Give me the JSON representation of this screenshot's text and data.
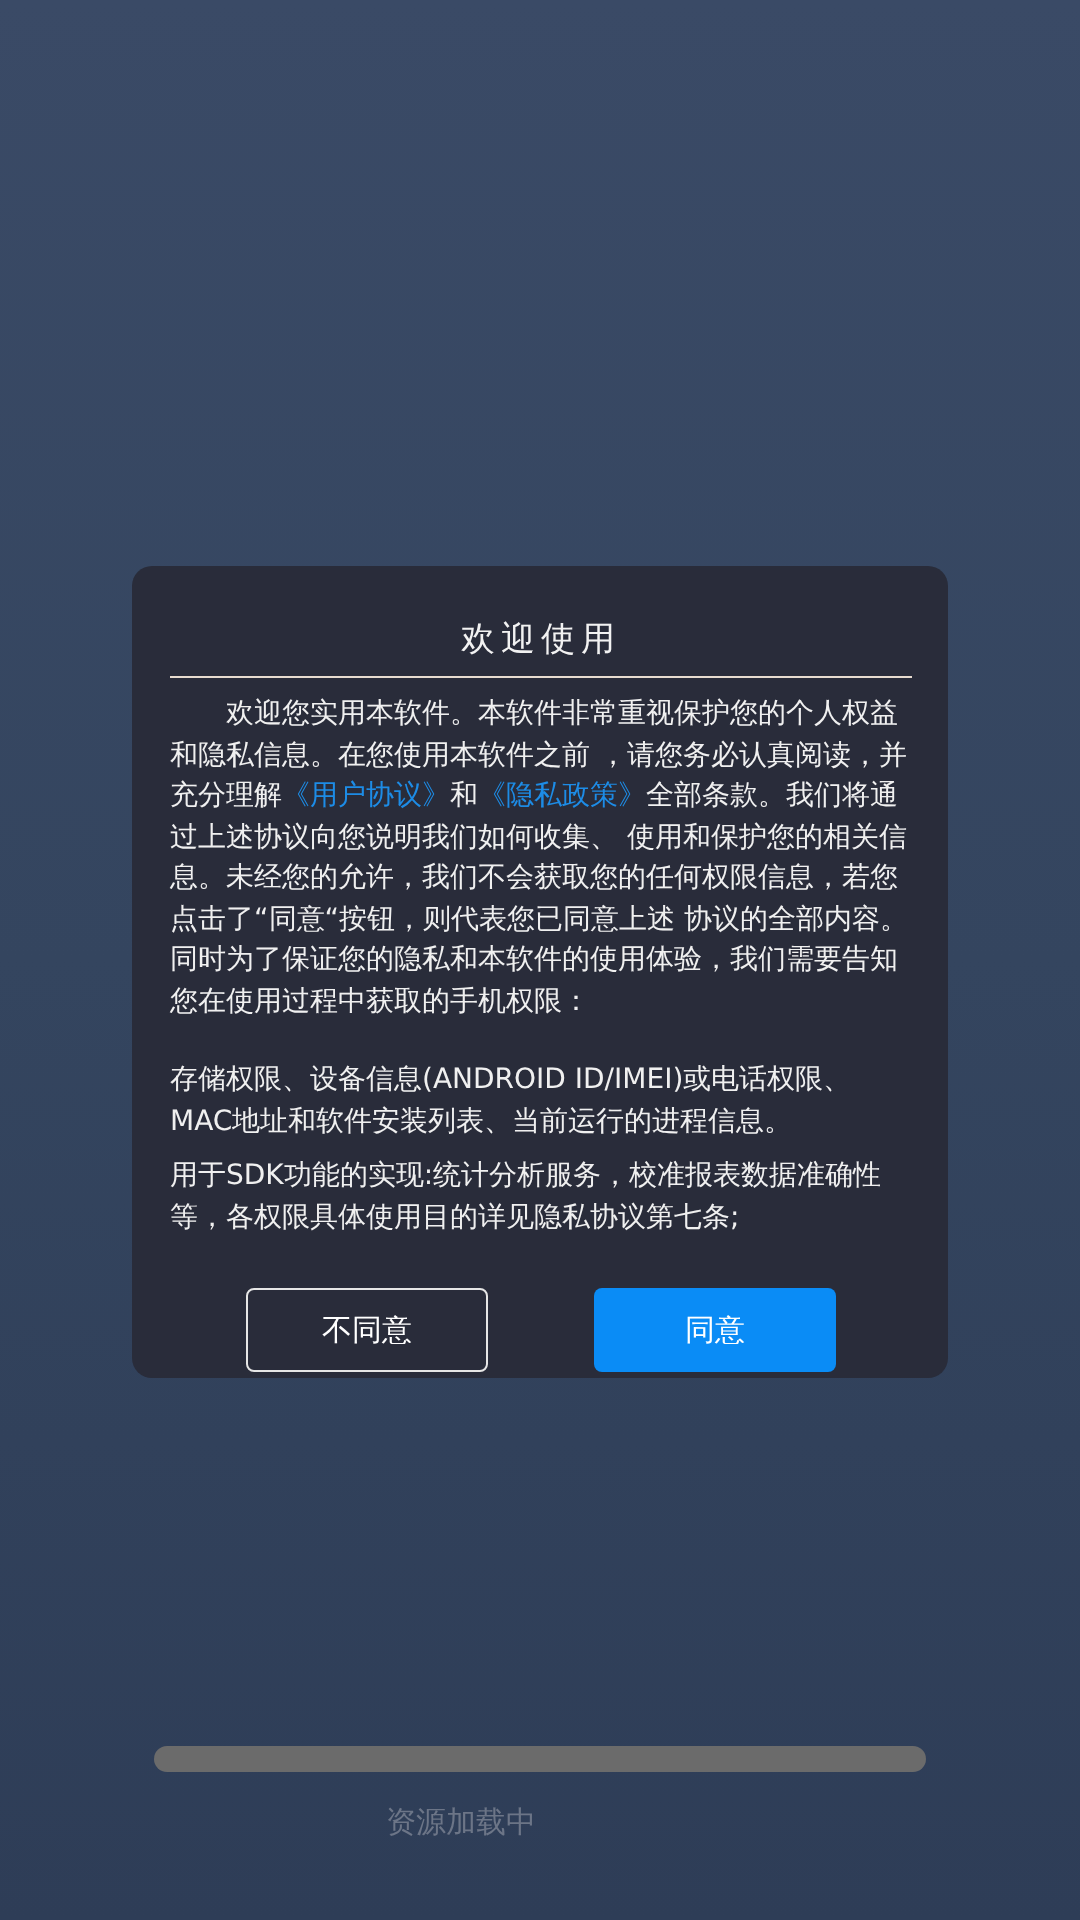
{
  "dialog": {
    "title": "欢迎使用",
    "intro": {
      "before": "欢迎您实用本软件。本软件非常重视保护您的个人权益和隐私信息。在您使用本软件之前 ，请您务必认真阅读，并充分理解",
      "link_1": "《用户协议》",
      "middle": "和",
      "link_2": "《隐私政策》",
      "after": "全部条款。我们将通过上述协议向您说明我们如何收集、 使用和保护您的相关信息。未经您的允许，我们不会获取您的任何权限信息，若您点击了“同意“按钮，则代表您已同意上述 协议的全部内容。同时为了保证您的隐私和本软件的使用体验，我们需要告知您在使用过程中获取的手机权限："
    },
    "paragraphs": [
      "存储权限、设备信息(ANDROID ID/IMEI)或电话权限、MAC地址和软件安装列表、当前运行的进程信息。",
      "用于SDK功能的实现:统计分析服务，校准报表数据准确性等，各权限具体使用目的详见隐私协议第七条;"
    ],
    "buttons": [
      {
        "label": "不同意",
        "kind": "outline"
      },
      {
        "label": "同意",
        "kind": "primary"
      }
    ]
  },
  "loading": {
    "text": "资源加载中"
  }
}
